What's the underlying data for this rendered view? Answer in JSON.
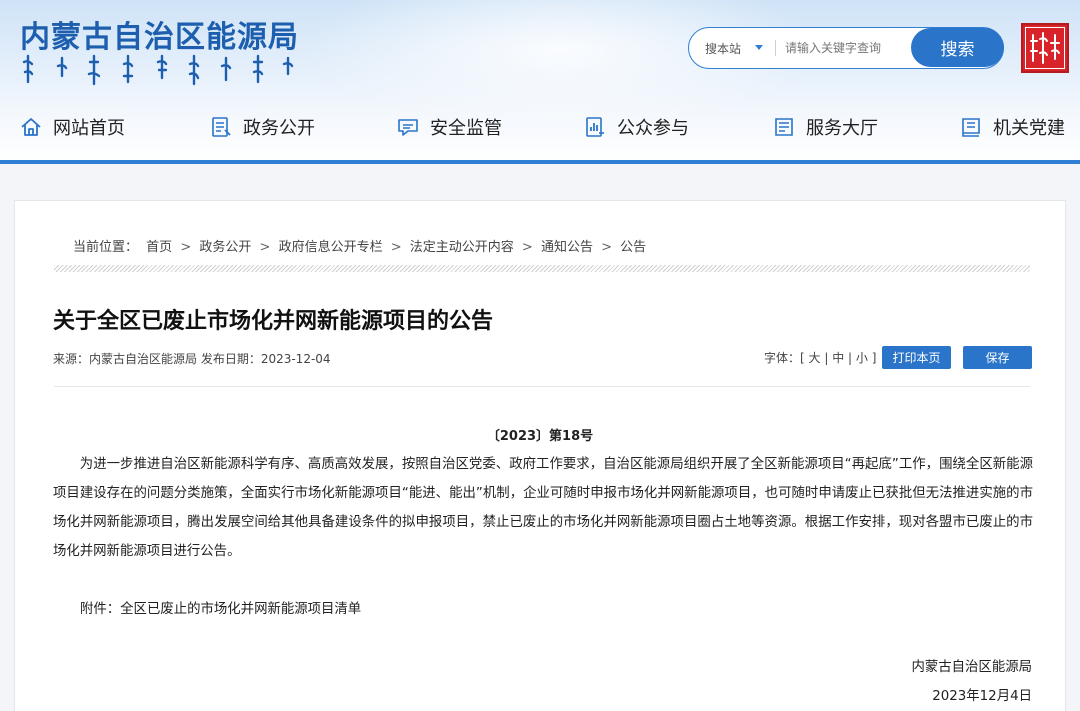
{
  "header": {
    "site_title": "内蒙古自治区能源局",
    "search": {
      "scope": "搜本站",
      "placeholder": "请输入关键字查询",
      "button": "搜索"
    },
    "seal_text": "内蒙古"
  },
  "nav": [
    {
      "label": "网站首页",
      "icon": "home-icon"
    },
    {
      "label": "政务公开",
      "icon": "document-list-icon"
    },
    {
      "label": "安全监管",
      "icon": "chat-icon"
    },
    {
      "label": "公众参与",
      "icon": "chart-doc-icon"
    },
    {
      "label": "服务大厅",
      "icon": "service-book-icon"
    },
    {
      "label": "机关党建",
      "icon": "party-book-icon"
    }
  ],
  "breadcrumb": {
    "prefix": "当前位置：",
    "items": [
      "首页",
      "政务公开",
      "政府信息公开专栏",
      "法定主动公开内容",
      "通知公告",
      "公告"
    ],
    "separator": ">"
  },
  "article": {
    "title": "关于全区已废止市场化并网新能源项目的公告",
    "meta": "来源：内蒙古自治区能源局 发布日期：2023-12-04",
    "font_size_label": "字体：",
    "font_sizes": [
      "大",
      "中",
      "小"
    ],
    "print_button": "打印本页",
    "save_button": "保存",
    "doc_number": "〔2023〕第18号",
    "body": "为进一步推进自治区新能源科学有序、高质高效发展，按照自治区党委、政府工作要求，自治区能源局组织开展了全区新能源项目“再起底”工作，围绕全区新能源项目建设存在的问题分类施策，全面实行市场化新能源项目“能进、能出”机制，企业可随时申报市场化并网新能源项目，也可随时申请废止已获批但无法推进实施的市场化并网新能源项目，腾出发展空间给其他具备建设条件的拟申报项目，禁止已废止的市场化并网新能源项目圈占土地等资源。根据工作安排，现对各盟市已废止的市场化并网新能源项目进行公告。",
    "attachment": "附件：全区已废止的市场化并网新能源项目清单",
    "sign_org": "内蒙古自治区能源局",
    "sign_date": "2023年12月4日"
  },
  "colors": {
    "brand_blue": "#2a74c9",
    "title_blue": "#1d5fae",
    "seal_red": "#d9232a"
  }
}
